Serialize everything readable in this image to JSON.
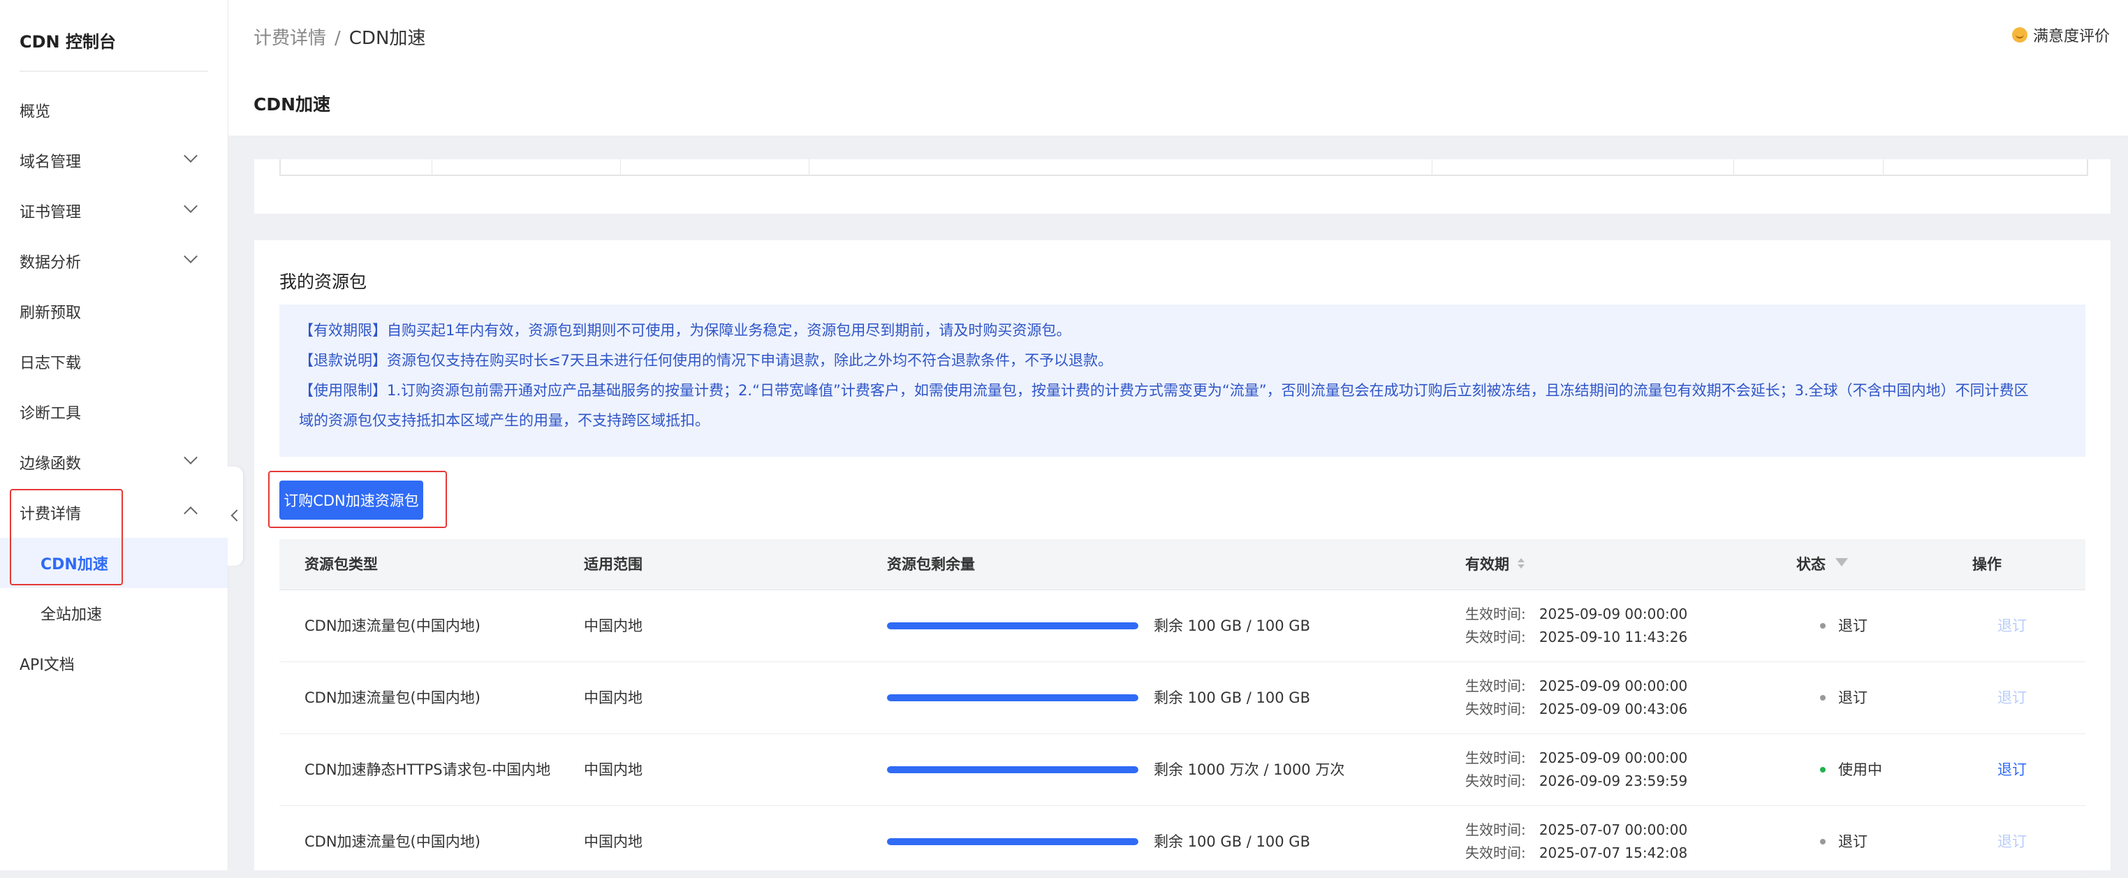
{
  "sidebar": {
    "brand": "CDN 控制台",
    "items": [
      {
        "label": "概览"
      },
      {
        "label": "域名管理"
      },
      {
        "label": "证书管理"
      },
      {
        "label": "数据分析"
      },
      {
        "label": "刷新预取"
      },
      {
        "label": "日志下载"
      },
      {
        "label": "诊断工具"
      },
      {
        "label": "边缘函数"
      },
      {
        "label": "计费详情"
      },
      {
        "label": "CDN加速"
      },
      {
        "label": "全站加速"
      },
      {
        "label": "API文档"
      }
    ]
  },
  "header": {
    "breadcrumb_parent": "计费详情",
    "breadcrumb_sep": "/",
    "breadcrumb_current": "CDN加速",
    "satisfaction": "满意度评价"
  },
  "page": {
    "title": "CDN加速"
  },
  "packages": {
    "title": "我的资源包",
    "notices": [
      "【有效期限】自购买起1年内有效，资源包到期则不可使用，为保障业务稳定，资源包用尽到期前，请及时购买资源包。",
      "【退款说明】资源包仅支持在购买时长≤7天且未进行任何使用的情况下申请退款，除此之外均不符合退款条件，不予以退款。",
      "【使用限制】1.订购资源包前需开通对应产品基础服务的按量计费；2.“日带宽峰值”计费客户，如需使用流量包，按量计费的计费方式需变更为“流量”，否则流量包会在成功订购后立刻被冻结，且冻结期间的流量包有效期不会延长；3.全球（不含中国内地）不同计费区",
      "域的资源包仅支持抵扣本区域产生的用量，不支持跨区域抵扣。"
    ],
    "buy_button": "订购CDN加速资源包",
    "columns": {
      "type": "资源包类型",
      "scope": "适用范围",
      "remaining": "资源包剩余量",
      "validity": "有效期",
      "status": "状态",
      "action": "操作"
    },
    "validity_start_label": "生效时间:",
    "validity_end_label": "失效时间:",
    "rows": [
      {
        "type": "CDN加速流量包(中国内地)",
        "scope": "中国内地",
        "remain_ratio": 1.0,
        "remaining": "剩余 100 GB / 100 GB",
        "start": "2025-09-09 00:00:00",
        "end": "2025-09-10 11:43:26",
        "status": "退订",
        "status_color": "#999999",
        "action": "退订",
        "action_enabled": false
      },
      {
        "type": "CDN加速流量包(中国内地)",
        "scope": "中国内地",
        "remain_ratio": 1.0,
        "remaining": "剩余 100 GB / 100 GB",
        "start": "2025-09-09 00:00:00",
        "end": "2025-09-09 00:43:06",
        "status": "退订",
        "status_color": "#999999",
        "action": "退订",
        "action_enabled": false
      },
      {
        "type": "CDN加速静态HTTPS请求包-中国内地",
        "scope": "中国内地",
        "remain_ratio": 1.0,
        "remaining": "剩余 1000 万次 / 1000 万次",
        "start": "2025-09-09 00:00:00",
        "end": "2026-09-09 23:59:59",
        "status": "使用中",
        "status_color": "#22b14c",
        "action": "退订",
        "action_enabled": true
      },
      {
        "type": "CDN加速流量包(中国内地)",
        "scope": "中国内地",
        "remain_ratio": 1.0,
        "remaining": "剩余 100 GB / 100 GB",
        "start": "2025-07-07 00:00:00",
        "end": "2025-07-07 15:42:08",
        "status": "退订",
        "status_color": "#999999",
        "action": "退订",
        "action_enabled": false
      }
    ]
  }
}
